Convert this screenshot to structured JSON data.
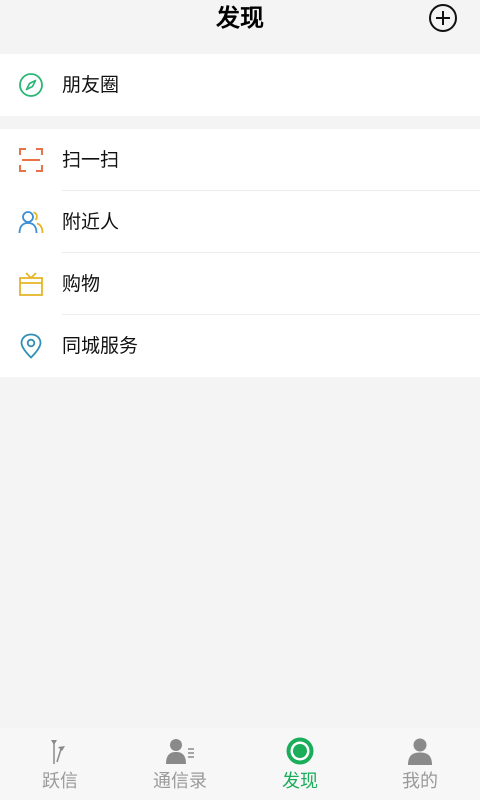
{
  "header": {
    "title": "发现",
    "add_icon": "plus-circle-icon"
  },
  "groups": [
    {
      "items": [
        {
          "label": "朋友圈",
          "icon": "compass-icon",
          "color": "#2bb673"
        }
      ]
    },
    {
      "items": [
        {
          "label": "扫一扫",
          "icon": "scan-icon",
          "color": "#e8734a"
        },
        {
          "label": "附近人",
          "icon": "people-nearby-icon",
          "color": "#3a8fd6"
        },
        {
          "label": "购物",
          "icon": "shopping-tv-icon",
          "color": "#e6b52a"
        },
        {
          "label": "同城服务",
          "icon": "location-pin-icon",
          "color": "#2f8fb5"
        }
      ]
    }
  ],
  "tabbar": {
    "tabs": [
      {
        "label": "跃信",
        "icon": "flowers-icon",
        "active": false
      },
      {
        "label": "通信录",
        "icon": "contacts-icon",
        "active": false
      },
      {
        "label": "发现",
        "icon": "discover-icon",
        "active": true
      },
      {
        "label": "我的",
        "icon": "person-icon",
        "active": false
      }
    ],
    "active_color": "#1aad5a",
    "inactive_color": "#9a9a9a"
  }
}
